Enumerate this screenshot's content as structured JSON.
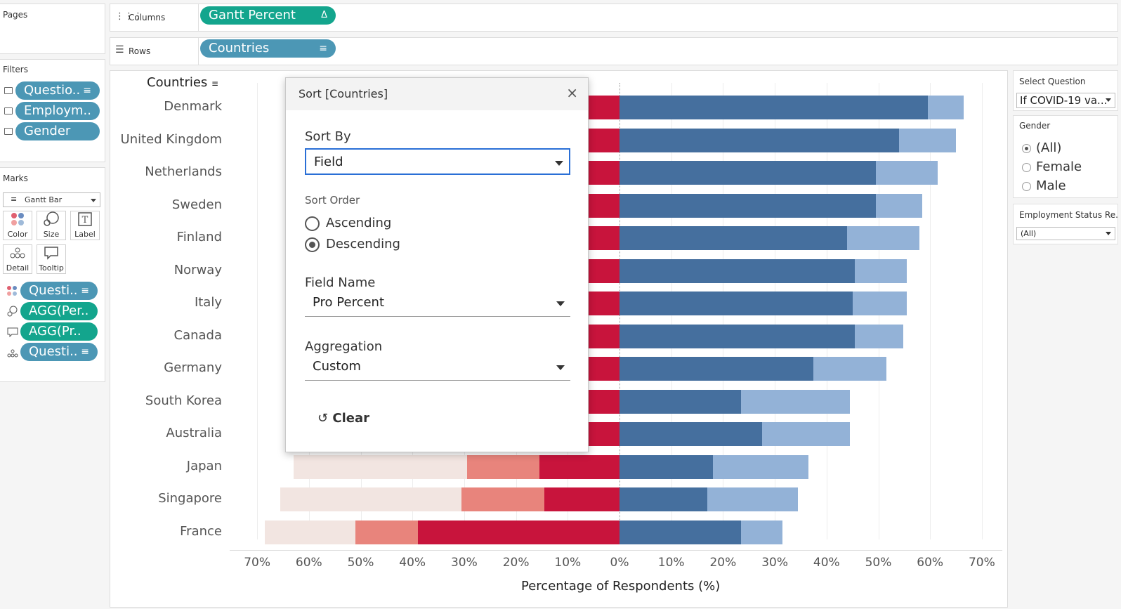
{
  "pages": {
    "title": "Pages"
  },
  "columns_shelf": {
    "title": "Columns",
    "pill": "Gantt Percent",
    "pill_icon": "delta-icon"
  },
  "rows_shelf": {
    "title": "Rows",
    "pill": "Countries",
    "pill_icon": "sort-icon"
  },
  "filters": {
    "title": "Filters",
    "items": [
      {
        "label": "Questio.."
      },
      {
        "label": "Employm.."
      },
      {
        "label": "Gender"
      }
    ]
  },
  "marks": {
    "title": "Marks",
    "type": "Gantt Bar",
    "buttons": [
      {
        "label": "Color"
      },
      {
        "label": "Size"
      },
      {
        "label": "Label"
      },
      {
        "label": "Detail"
      },
      {
        "label": "Tooltip"
      }
    ],
    "pills": [
      {
        "label": "Questi.."
      },
      {
        "label": "AGG(Per.."
      },
      {
        "label": "AGG(Pr.."
      },
      {
        "label": "Questi.."
      }
    ]
  },
  "view": {
    "rows_header": "Countries"
  },
  "chart_data": {
    "type": "bar",
    "stacked": "diverging",
    "xlabel": "Percentage of Respondents (%)",
    "ylabel": "",
    "x_ticks": [
      "70%",
      "60%",
      "50%",
      "40%",
      "30%",
      "20%",
      "10%",
      "0%",
      "10%",
      "20%",
      "30%",
      "40%",
      "50%",
      "60%",
      "70%"
    ],
    "xlim": [
      -70,
      70
    ],
    "grid": true,
    "categories": [
      "Denmark",
      "United Kingdom",
      "Netherlands",
      "Sweden",
      "Finland",
      "Norway",
      "Italy",
      "Canada",
      "Germany",
      "South Korea",
      "Australia",
      "Japan",
      "Singapore",
      "France"
    ],
    "series": [
      {
        "side": "negative",
        "color": "#c8143c",
        "values": [
          6,
          6,
          6,
          6,
          6,
          6,
          6,
          6,
          6,
          6,
          6,
          15.5,
          14.5,
          39
        ]
      },
      {
        "side": "negative",
        "color": "#e8847c",
        "values": [
          0,
          0,
          0,
          0,
          0,
          0,
          0,
          0,
          0,
          0,
          0,
          14,
          16,
          12
        ]
      },
      {
        "side": "negative",
        "color": "#f2e5e1",
        "values": [
          0,
          0,
          0,
          0,
          0,
          0,
          0,
          0,
          0,
          0,
          0,
          33.5,
          35,
          17.5
        ]
      },
      {
        "side": "positive",
        "color": "#456f9e",
        "values": [
          59.5,
          54,
          49.5,
          49.5,
          44,
          45.5,
          45,
          45.5,
          37.5,
          23.5,
          27.5,
          18,
          17,
          23.5
        ]
      },
      {
        "side": "positive",
        "color": "#93b2d7",
        "values": [
          7,
          11,
          12,
          9,
          14,
          10,
          10.5,
          9.3,
          14,
          21,
          17,
          18.5,
          17.5,
          8
        ]
      }
    ]
  },
  "sort_dialog": {
    "title": "Sort [Countries]",
    "sort_by_label": "Sort By",
    "sort_by_value": "Field",
    "sort_order_label": "Sort Order",
    "ascending": "Ascending",
    "descending": "Descending",
    "selected_order": "Descending",
    "field_name_label": "Field Name",
    "field_name_value": "Pro Percent",
    "aggregation_label": "Aggregation",
    "aggregation_value": "Custom",
    "clear_label": "Clear"
  },
  "right_panel": {
    "select_question_title": "Select Question",
    "select_question_value": "If COVID-19 va...",
    "gender_title": "Gender",
    "gender_options": [
      "(All)",
      "Female",
      "Male"
    ],
    "gender_selected": "(All)",
    "employment_title": "Employment Status Re...",
    "employment_value": "(All)"
  },
  "colors": {
    "pill_blue": "#4c97b5",
    "pill_green": "#13a58d",
    "dialog_focus": "#2a6fd6"
  }
}
